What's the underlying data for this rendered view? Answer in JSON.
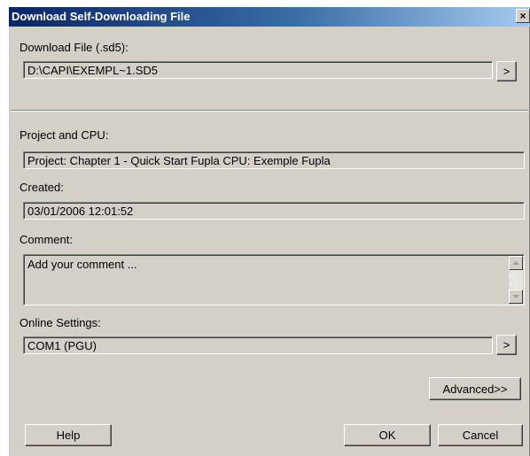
{
  "window": {
    "title": "Download Self-Downloading File",
    "close_glyph": "×"
  },
  "download": {
    "label": "Download File (.sd5):",
    "value": "D:\\CAPI\\EXEMPL~1.SD5",
    "browse_label": ">"
  },
  "project": {
    "label": "Project and CPU:",
    "value": "Project: Chapter 1 - Quick Start Fupla  CPU: Exemple Fupla"
  },
  "created": {
    "label": "Created:",
    "value": "03/01/2006 12:01:52"
  },
  "comment": {
    "label": "Comment:",
    "value": "Add your comment ..."
  },
  "online": {
    "label": "Online Settings:",
    "value": "COM1 (PGU)",
    "browse_label": ">"
  },
  "buttons": {
    "advanced": "Advanced>>",
    "help": "Help",
    "ok": "OK",
    "cancel": "Cancel"
  }
}
